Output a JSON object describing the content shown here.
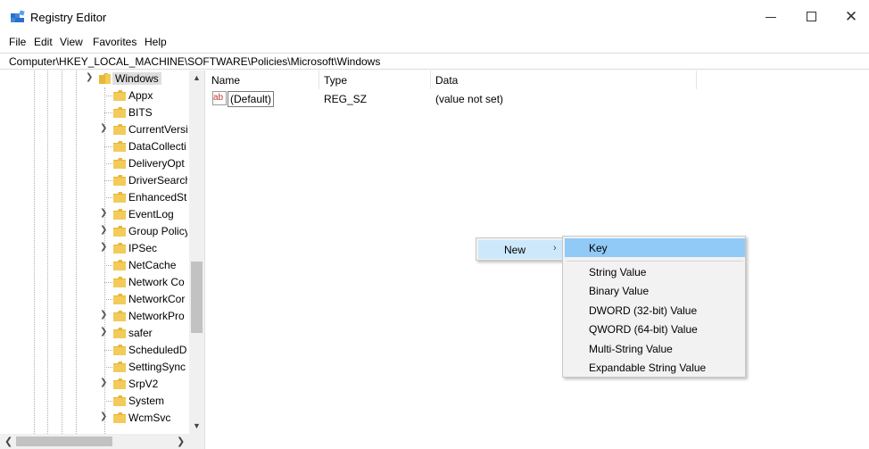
{
  "window": {
    "title": "Registry Editor",
    "close_glyph": "✕"
  },
  "menu": [
    "File",
    "Edit",
    "View",
    "Favorites",
    "Help"
  ],
  "address": "Computer\\HKEY_LOCAL_MACHINE\\SOFTWARE\\Policies\\Microsoft\\Windows",
  "tree": {
    "root": {
      "label": "Windows",
      "expanded": true
    },
    "children": [
      {
        "label": "Appx",
        "has_children": false
      },
      {
        "label": "BITS",
        "has_children": false
      },
      {
        "label": "CurrentVersi",
        "has_children": true
      },
      {
        "label": "DataCollecti",
        "has_children": false
      },
      {
        "label": "DeliveryOpt",
        "has_children": false
      },
      {
        "label": "DriverSearch",
        "has_children": false
      },
      {
        "label": "EnhancedSto",
        "has_children": false
      },
      {
        "label": "EventLog",
        "has_children": true
      },
      {
        "label": "Group Policy",
        "has_children": true
      },
      {
        "label": "IPSec",
        "has_children": true
      },
      {
        "label": "NetCache",
        "has_children": false
      },
      {
        "label": "Network Co",
        "has_children": false
      },
      {
        "label": "NetworkCor",
        "has_children": false
      },
      {
        "label": "NetworkPro",
        "has_children": true
      },
      {
        "label": "safer",
        "has_children": true
      },
      {
        "label": "ScheduledD",
        "has_children": false
      },
      {
        "label": "SettingSync",
        "has_children": false
      },
      {
        "label": "SrpV2",
        "has_children": true
      },
      {
        "label": "System",
        "has_children": false
      },
      {
        "label": "WcmSvc",
        "has_children": true
      }
    ]
  },
  "list": {
    "columns": {
      "name": "Name",
      "type": "Type",
      "data": "Data"
    },
    "rows": [
      {
        "name": "(Default)",
        "type": "REG_SZ",
        "data": "(value not set)",
        "icon": "string-value-icon",
        "icon_text": "ab"
      }
    ]
  },
  "context_menu": {
    "parent_item": "New",
    "submenu": [
      "Key",
      "String Value",
      "Binary Value",
      "DWORD (32-bit) Value",
      "QWORD (64-bit) Value",
      "Multi-String Value",
      "Expandable String Value"
    ],
    "highlighted": "Key"
  },
  "colors": {
    "menu_hover": "#cde8fb",
    "submenu_highlight": "#91c9f7",
    "folder": "#e8b836",
    "string_icon": "#c0392b"
  }
}
